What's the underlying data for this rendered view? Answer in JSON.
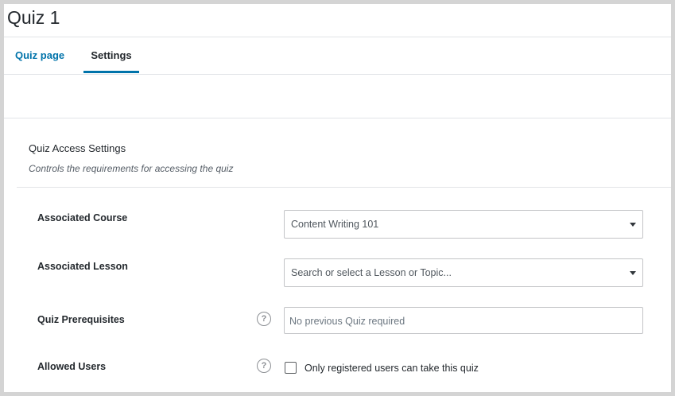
{
  "page": {
    "title": "Quiz 1"
  },
  "tabs": [
    {
      "label": "Quiz page",
      "active": false
    },
    {
      "label": "Settings",
      "active": true
    }
  ],
  "section": {
    "title": "Quiz Access Settings",
    "description": "Controls the requirements for accessing the quiz"
  },
  "fields": {
    "associated_course": {
      "label": "Associated Course",
      "value": "Content Writing 101"
    },
    "associated_lesson": {
      "label": "Associated Lesson",
      "placeholder": "Search or select a Lesson or Topic..."
    },
    "quiz_prerequisites": {
      "label": "Quiz Prerequisites",
      "placeholder": "No previous Quiz required"
    },
    "allowed_users": {
      "label": "Allowed Users",
      "checkbox_label": "Only registered users can take this quiz",
      "checked": false
    }
  },
  "icons": {
    "help": "?"
  },
  "colors": {
    "accent": "#0073aa",
    "text": "#23282d",
    "border": "#c3c4c7"
  }
}
